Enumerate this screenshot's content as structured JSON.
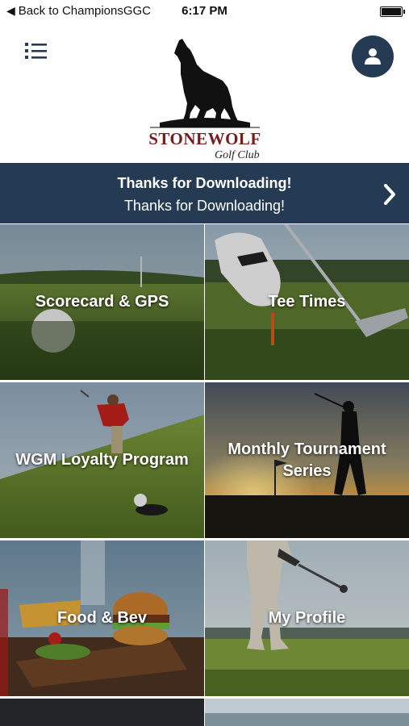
{
  "status": {
    "back_label": "Back to ChampionsGGC",
    "time": "6:17 PM"
  },
  "header": {
    "logo_name": "STONEWOLF",
    "logo_sub": "Golf Club"
  },
  "banner": {
    "title": "Thanks for Downloading!",
    "subtitle": "Thanks for Downloading!"
  },
  "tiles": [
    {
      "label": "Scorecard & GPS"
    },
    {
      "label": "Tee Times"
    },
    {
      "label": "WGM Loyalty Program"
    },
    {
      "label": "Monthly Tournament Series"
    },
    {
      "label": "Food & Bev"
    },
    {
      "label": "My Profile"
    }
  ],
  "colors": {
    "navy": "#253a53",
    "brand_red": "#7b1c1c"
  },
  "icons": {
    "menu": "menu-list-icon",
    "profile": "user-icon",
    "banner_arrow": "chevron-right-icon",
    "back": "chevron-left-icon"
  }
}
